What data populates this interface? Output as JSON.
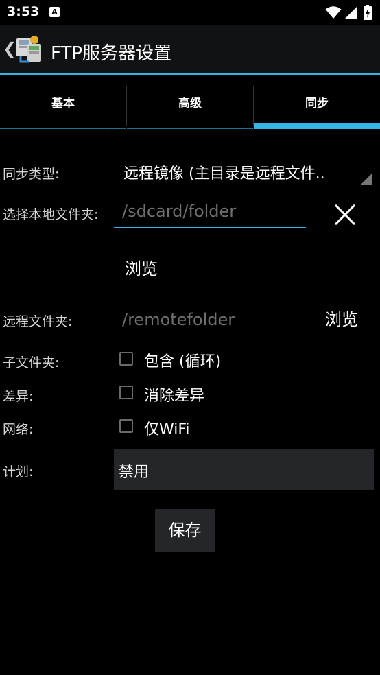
{
  "status_bar": {
    "time": "3:53",
    "notification_glyph": "A"
  },
  "action_bar": {
    "back_glyph": "❮",
    "title": "FTP服务器设置",
    "accent": "#33b5e5"
  },
  "tabs": [
    {
      "label": "基本",
      "active": false
    },
    {
      "label": "高级",
      "active": false
    },
    {
      "label": "同步",
      "active": true
    }
  ],
  "form": {
    "sync_type": {
      "label": "同步类型:",
      "value": "远程镜像 (主目录是远程文件.."
    },
    "local_folder": {
      "label": "选择本地文件夹:",
      "placeholder": "/sdcard/folder",
      "browse_label": "浏览"
    },
    "remote_folder": {
      "label": "远程文件夹:",
      "placeholder": "/remotefolder",
      "browse_label": "浏览"
    },
    "subfolders": {
      "label": "子文件夹:",
      "checkbox_label": "包含 (循环)",
      "checked": false
    },
    "diff": {
      "label": "差异:",
      "checkbox_label": "消除差异",
      "checked": false
    },
    "network": {
      "label": "网络:",
      "checkbox_label": "仅WiFi",
      "checked": false
    },
    "schedule": {
      "label": "计划:",
      "value": "禁用"
    },
    "save_label": "保存"
  }
}
